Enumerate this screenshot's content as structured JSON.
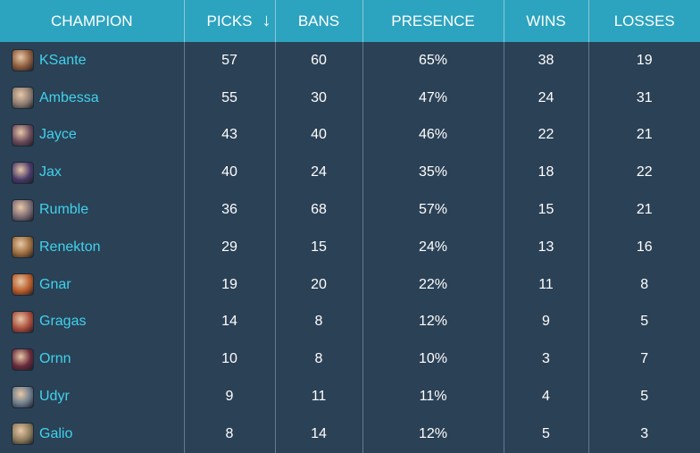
{
  "table": {
    "headers": {
      "champion": "CHAMPION",
      "picks": "PICKS",
      "bans": "BANS",
      "presence": "PRESENCE",
      "wins": "WINS",
      "losses": "LOSSES"
    },
    "sort_icon": "↓",
    "rows": [
      {
        "champion": "KSante",
        "icon_color": "#8a5a3a",
        "picks": "57",
        "bans": "60",
        "presence": "65%",
        "wins": "38",
        "losses": "19"
      },
      {
        "champion": "Ambessa",
        "icon_color": "#8a7a70",
        "picks": "55",
        "bans": "30",
        "presence": "47%",
        "wins": "24",
        "losses": "31"
      },
      {
        "champion": "Jayce",
        "icon_color": "#6a4a5a",
        "picks": "43",
        "bans": "40",
        "presence": "46%",
        "wins": "22",
        "losses": "21"
      },
      {
        "champion": "Jax",
        "icon_color": "#4a3a6a",
        "picks": "40",
        "bans": "24",
        "presence": "35%",
        "wins": "18",
        "losses": "22"
      },
      {
        "champion": "Rumble",
        "icon_color": "#7a6a72",
        "picks": "36",
        "bans": "68",
        "presence": "57%",
        "wins": "15",
        "losses": "21"
      },
      {
        "champion": "Renekton",
        "icon_color": "#9a6a3a",
        "picks": "29",
        "bans": "15",
        "presence": "24%",
        "wins": "13",
        "losses": "16"
      },
      {
        "champion": "Gnar",
        "icon_color": "#b85a28",
        "picks": "19",
        "bans": "20",
        "presence": "22%",
        "wins": "11",
        "losses": "8"
      },
      {
        "champion": "Gragas",
        "icon_color": "#a84a3a",
        "picks": "14",
        "bans": "8",
        "presence": "12%",
        "wins": "9",
        "losses": "5"
      },
      {
        "champion": "Ornn",
        "icon_color": "#6a2a3a",
        "picks": "10",
        "bans": "8",
        "presence": "10%",
        "wins": "3",
        "losses": "7"
      },
      {
        "champion": "Udyr",
        "icon_color": "#6a7a8a",
        "picks": "9",
        "bans": "11",
        "presence": "11%",
        "wins": "4",
        "losses": "5"
      },
      {
        "champion": "Galio",
        "icon_color": "#8a7a5a",
        "picks": "8",
        "bans": "14",
        "presence": "12%",
        "wins": "5",
        "losses": "3"
      }
    ]
  }
}
